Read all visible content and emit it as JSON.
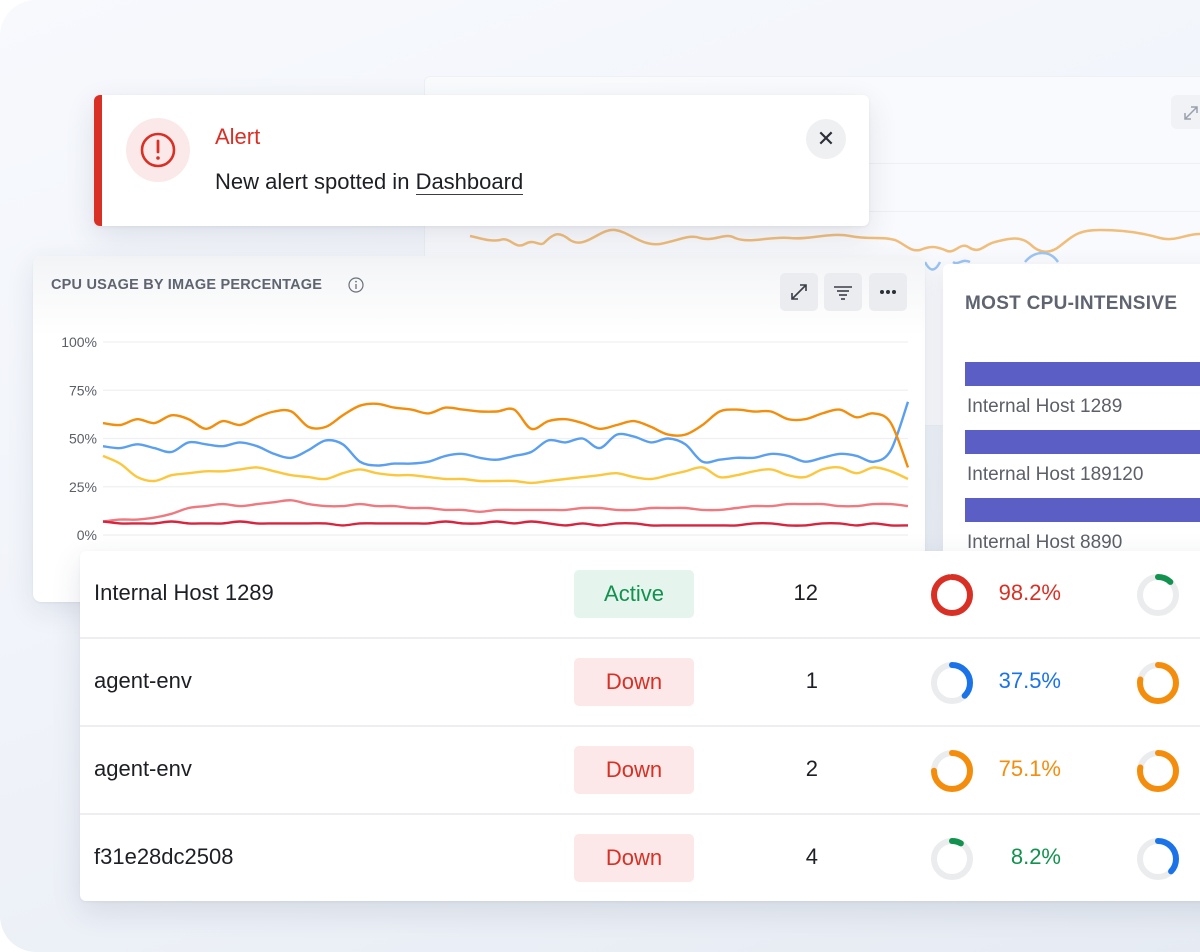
{
  "colors": {
    "alert_red": "#d93025",
    "active_green": "#12924f",
    "series_orange": "#f38d0b",
    "series_blue": "#5a9ff0",
    "series_yellow": "#fcc73c",
    "series_pink": "#ee7a80",
    "series_crimson": "#d7243f",
    "bar_purple": "#5b5ec4",
    "donut_red": "#d93025",
    "donut_blue": "#1a73e8",
    "donut_orange": "#f58d0c",
    "donut_green": "#12924f",
    "donut_track": "#ebeced"
  },
  "alert": {
    "title": "Alert",
    "message_prefix": "New alert spotted in",
    "link_text": "Dashboard",
    "icon": "exclamation-circle-icon",
    "close_icon": "close-icon",
    "close_glyph": "✕"
  },
  "cpu_card": {
    "title": "CPU USAGE BY IMAGE PERCENTAGE",
    "info_icon": "info-icon",
    "toolbar": [
      {
        "name": "expand-button",
        "icon": "expand-icon"
      },
      {
        "name": "filter-button",
        "icon": "filter-icon"
      },
      {
        "name": "more-button",
        "icon": "more-icon"
      }
    ]
  },
  "chart_data": {
    "type": "line",
    "title": "CPU USAGE BY IMAGE PERCENTAGE",
    "xlabel": "",
    "ylabel": "",
    "ylim": [
      0,
      100
    ],
    "yticks": [
      "0%",
      "25%",
      "50%",
      "75%",
      "100%"
    ],
    "ytick_values": [
      0,
      25,
      50,
      75,
      100
    ],
    "grid": true,
    "legend": "none",
    "x_count": 48,
    "series": [
      {
        "name": "orange",
        "color": "#f38d0b",
        "values": [
          58,
          57,
          60,
          58,
          62,
          60,
          55,
          59,
          57,
          61,
          64,
          64,
          56,
          56,
          62,
          67,
          68,
          66,
          65,
          63,
          66,
          65,
          64,
          64,
          65,
          55,
          59,
          60,
          58,
          55,
          57,
          59,
          56,
          52,
          52,
          57,
          64,
          65,
          64,
          64,
          60,
          60,
          63,
          65,
          61,
          63,
          58,
          35
        ]
      },
      {
        "name": "blue",
        "color": "#5a9ff0",
        "values": [
          46,
          45,
          47,
          45,
          43,
          48,
          47,
          46,
          48,
          46,
          42,
          40,
          44,
          49,
          47,
          38,
          36,
          37,
          37,
          38,
          41,
          42,
          40,
          39,
          41,
          43,
          49,
          48,
          50,
          45,
          52,
          51,
          48,
          50,
          47,
          38,
          39,
          40,
          40,
          42,
          41,
          38,
          40,
          42,
          41,
          38,
          44,
          69
        ]
      },
      {
        "name": "yellow",
        "color": "#fcc73c",
        "values": [
          41,
          37,
          30,
          28,
          31,
          32,
          33,
          33,
          34,
          35,
          33,
          31,
          30,
          29,
          32,
          34,
          32,
          31,
          31,
          30,
          29,
          29,
          28,
          28,
          28,
          27,
          28,
          29,
          30,
          31,
          32,
          30,
          29,
          31,
          33,
          35,
          30,
          31,
          33,
          34,
          31,
          30,
          34,
          35,
          32,
          35,
          33,
          29
        ]
      },
      {
        "name": "pink",
        "color": "#ee7a80",
        "values": [
          7,
          8,
          8,
          9,
          11,
          14,
          15,
          16,
          15,
          16,
          17,
          18,
          16,
          15,
          15,
          16,
          15,
          15,
          14,
          14,
          13,
          13,
          12,
          13,
          13,
          13,
          13,
          13,
          14,
          14,
          13,
          13,
          14,
          14,
          14,
          13,
          13,
          14,
          15,
          15,
          16,
          16,
          16,
          15,
          15,
          16,
          16,
          15
        ]
      },
      {
        "name": "crimson",
        "color": "#d7243f",
        "values": [
          7,
          6,
          6,
          6,
          7,
          6,
          6,
          6,
          7,
          6,
          6,
          6,
          6,
          6,
          5,
          6,
          6,
          6,
          6,
          6,
          7,
          6,
          6,
          7,
          6,
          7,
          6,
          5,
          6,
          5,
          6,
          6,
          5,
          5,
          5,
          5,
          5,
          5,
          6,
          6,
          5,
          5,
          6,
          6,
          5,
          6,
          5,
          5
        ]
      }
    ]
  },
  "intense_card": {
    "title": "MOST CPU-INTENSIVE",
    "bars": [
      {
        "label": "Internal Host 1289"
      },
      {
        "label": "Internal Host 189120"
      },
      {
        "label": "Internal Host 8890"
      }
    ]
  },
  "table": {
    "rows": [
      {
        "name": "Internal Host 1289",
        "status": "Active",
        "status_type": "active",
        "count": "12",
        "metric1": {
          "value": 98.2,
          "label": "98.2%",
          "color": "#d93025"
        },
        "metric2": {
          "value": 12,
          "color": "#12924f"
        }
      },
      {
        "name": "agent-env",
        "status": "Down",
        "status_type": "down",
        "count": "1",
        "metric1": {
          "value": 37.5,
          "label": "37.5%",
          "color": "#1a73e8"
        },
        "metric2": {
          "value": 78,
          "color": "#f58d0c"
        }
      },
      {
        "name": "agent-env",
        "status": "Down",
        "status_type": "down",
        "count": "2",
        "metric1": {
          "value": 75.1,
          "label": "75.1%",
          "color": "#f58d0c"
        },
        "metric2": {
          "value": 78,
          "color": "#f58d0c"
        }
      },
      {
        "name": "f31e28dc2508",
        "status": "Down",
        "status_type": "down",
        "count": "4",
        "metric1": {
          "value": 8.2,
          "label": "8.2%",
          "color": "#12924f"
        },
        "metric2": {
          "value": 37,
          "color": "#1a73e8"
        }
      }
    ]
  }
}
